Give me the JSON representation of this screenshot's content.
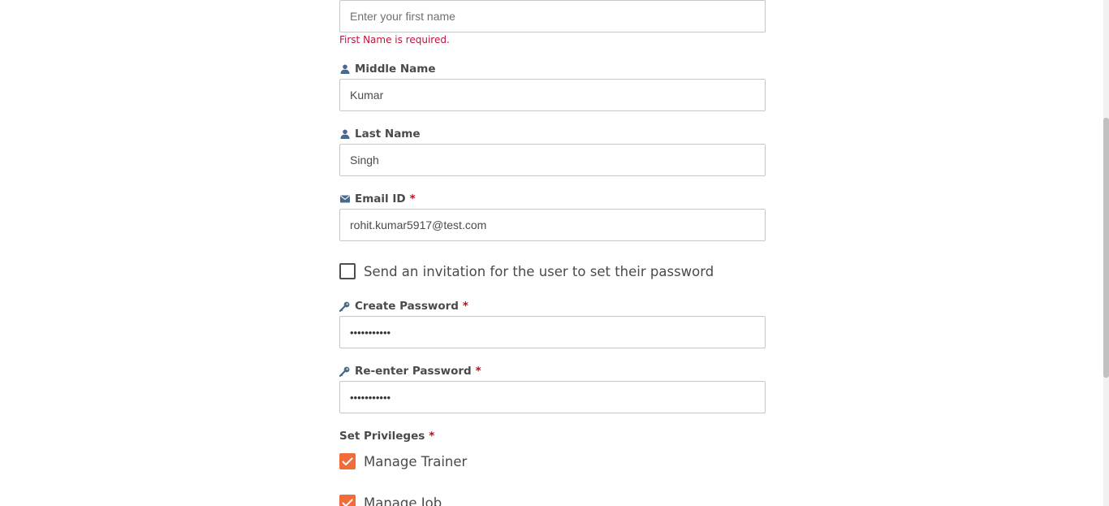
{
  "form": {
    "first_name": {
      "placeholder": "Enter your first name",
      "value": "",
      "error": "First Name is required."
    },
    "middle_name": {
      "label": "Middle Name",
      "icon": "user-icon",
      "value": "Kumar"
    },
    "last_name": {
      "label": "Last Name",
      "icon": "user-icon",
      "value": "Singh"
    },
    "email": {
      "label": "Email ID",
      "icon": "envelope-icon",
      "required_mark": "*",
      "value": "rohit.kumar5917@test.com"
    },
    "invite": {
      "label": "Send an invitation for the user to set their password",
      "checked": false
    },
    "create_password": {
      "label": "Create Password",
      "icon": "key-icon",
      "required_mark": "*",
      "value": "Password123"
    },
    "reenter_password": {
      "label": "Re-enter Password",
      "icon": "key-icon",
      "required_mark": "*",
      "value": "Password123"
    },
    "privileges": {
      "label": "Set Privileges",
      "required_mark": "*",
      "items": [
        {
          "label": "Manage Trainer",
          "checked": true
        },
        {
          "label": "Manage Job",
          "checked": true
        }
      ]
    }
  },
  "colors": {
    "accent": "#f26b3a",
    "error": "#c0123c",
    "required": "#d0021b",
    "icon": "#4a6a8a",
    "text": "#4a4a4a",
    "border": "#c7c7c7"
  }
}
